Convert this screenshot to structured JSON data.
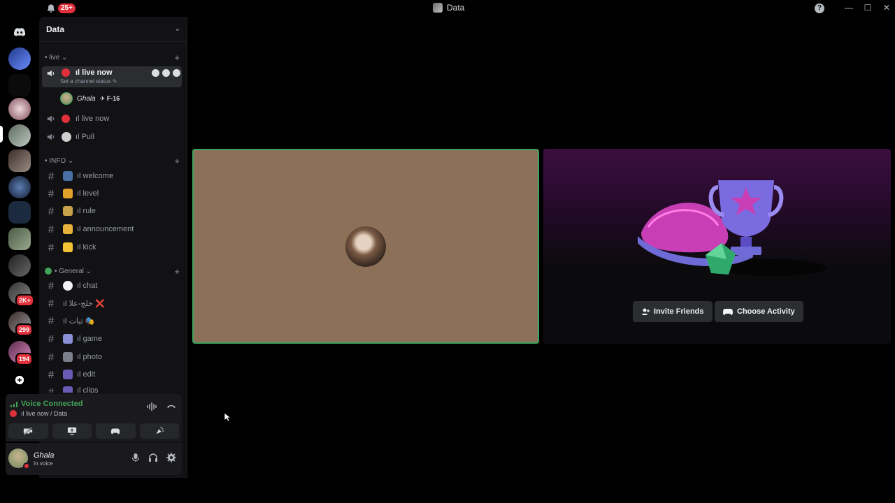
{
  "titlebar": {
    "notification_badge": "25+",
    "window_title": "Data",
    "help_glyph": "?",
    "minimize_glyph": "—",
    "maximize_glyph": "☐",
    "close_glyph": "✕"
  },
  "rail": {
    "badges": [
      "2K+",
      "299",
      "194"
    ]
  },
  "guild": {
    "name": "Data",
    "chevron": "⌄"
  },
  "categories": {
    "live": "• live ⌄",
    "info": "• INFO ⌄",
    "general": "• General ⌄",
    "plus": "+"
  },
  "voice_channels": [
    {
      "label": "ıl live now",
      "status": "Set a channel status ✎"
    },
    {
      "label": "ıl live now"
    },
    {
      "label": "ıl Pull"
    }
  ],
  "voice_user": {
    "name": "Ghala",
    "tag": "✈ F-16"
  },
  "info_channels": [
    {
      "label": "ıl welcome"
    },
    {
      "label": "ıl level"
    },
    {
      "label": "ıl rule"
    },
    {
      "label": "ıl announcement"
    },
    {
      "label": "ıl kick"
    }
  ],
  "general_channels": [
    {
      "label": "ıl chat"
    },
    {
      "label": "ıl خلج-علا ❌"
    },
    {
      "label": "ıl ثبات 🎭"
    },
    {
      "label": "ıl game"
    },
    {
      "label": "ıl photo"
    },
    {
      "label": "ıl edit"
    },
    {
      "label": "ıl clips"
    }
  ],
  "hash": "#",
  "voice_panel": {
    "status": "Voice Connected",
    "location": "ıl live now / Data"
  },
  "user_panel": {
    "name": "Ghala",
    "status": "In voice"
  },
  "activity": {
    "invite_label": "Invite Friends",
    "choose_label": "Choose Activity"
  },
  "colors": {
    "accent_green": "#3ba55d",
    "danger_red": "#e0303b",
    "sidebar_bg": "#121214",
    "camera_tile_bg": "#8d7058"
  }
}
